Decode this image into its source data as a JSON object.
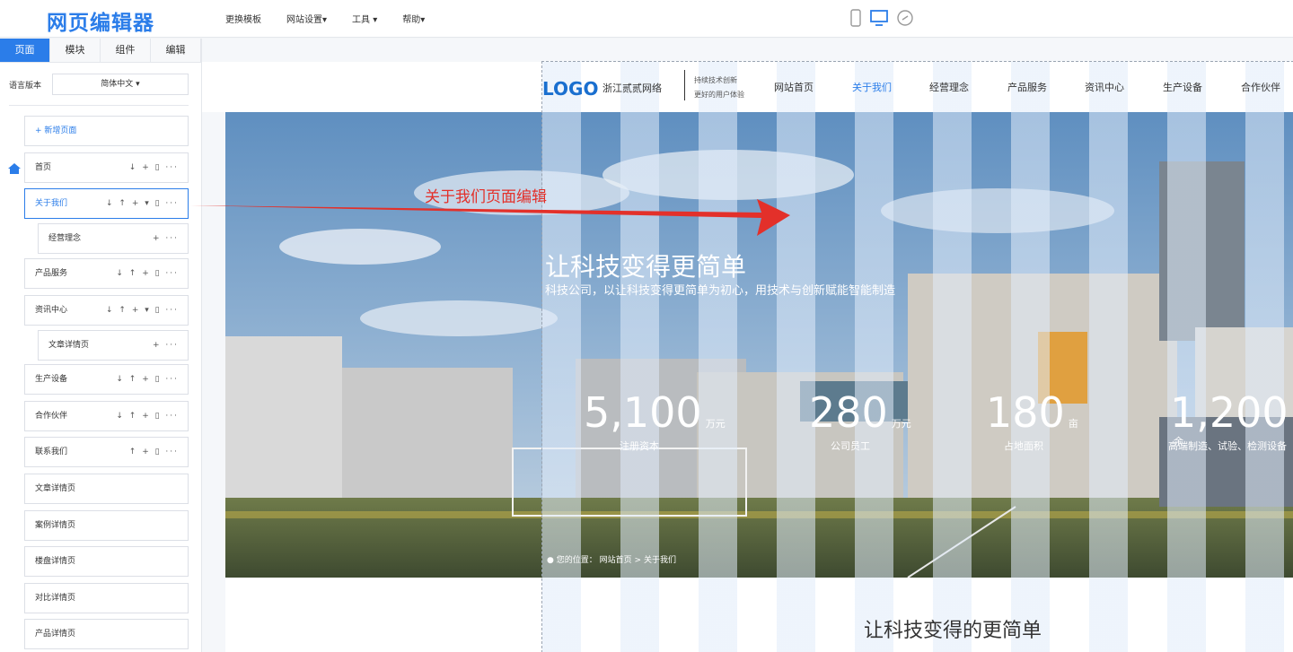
{
  "app": {
    "title": "网页编辑器"
  },
  "topnav": {
    "items": [
      "更换模板",
      "网站设置",
      "工具",
      "帮助"
    ]
  },
  "devices": {
    "icons": [
      "mobile-icon",
      "desktop-icon",
      "link-icon"
    ]
  },
  "sidebar": {
    "tabs": [
      "页面",
      "模块",
      "组件",
      "编辑"
    ],
    "lang_label": "语言版本",
    "lang_value": "简体中文",
    "add_page": "+ 新增页面",
    "pages": [
      {
        "label": "首页",
        "acts": "↓ + ▯ ···"
      },
      {
        "label": "关于我们",
        "acts": "↓ ↑ + ▾ ▯ ···"
      },
      {
        "label": "经营理念",
        "acts": "+ ···"
      },
      {
        "label": "产品服务",
        "acts": "↓ ↑ + ▯ ···"
      },
      {
        "label": "资讯中心",
        "acts": "↓ ↑ + ▾ ▯ ···"
      },
      {
        "label": "文章详情页",
        "acts": "+ ···"
      },
      {
        "label": "生产设备",
        "acts": "↓ ↑ + ▯ ···"
      },
      {
        "label": "合作伙伴",
        "acts": "↓ ↑ + ▯ ···"
      },
      {
        "label": "联系我们",
        "acts": "↑ + ▯ ···"
      },
      {
        "label": "文章详情页"
      },
      {
        "label": "案例详情页"
      },
      {
        "label": "楼盘详情页"
      },
      {
        "label": "对比详情页"
      },
      {
        "label": "产品详情页"
      }
    ]
  },
  "site": {
    "logo": "LOGO",
    "company": "浙江贰贰网络",
    "slogan1": "持续技术创新",
    "slogan2": "更好的用户体验",
    "nav": [
      "网站首页",
      "关于我们",
      "经营理念",
      "产品服务",
      "资讯中心",
      "生产设备",
      "合作伙伴"
    ],
    "hero_title": "让科技变得更简单",
    "hero_sub": "科技公司，以让科技变得更简单为初心，用技术与创新赋能智能制造",
    "stats": [
      {
        "num": "5,100",
        "unit": "万元",
        "label": "注册资本"
      },
      {
        "num": "280",
        "unit": "万元",
        "label": "公司员工"
      },
      {
        "num": "180",
        "unit": "亩",
        "label": "占地面积"
      },
      {
        "num": "1,200",
        "unit": "余",
        "label": "高端制造、试验、检测设备"
      }
    ],
    "crumb_label": "您的位置：",
    "crumb_home": "网站首页",
    "crumb_sep": ">",
    "crumb_cur": "关于我们",
    "section_title": "让科技变得的更简单"
  },
  "annotation": "关于我们页面编辑",
  "colors": {
    "accent": "#2b7de9",
    "annotation": "#e3302a"
  }
}
